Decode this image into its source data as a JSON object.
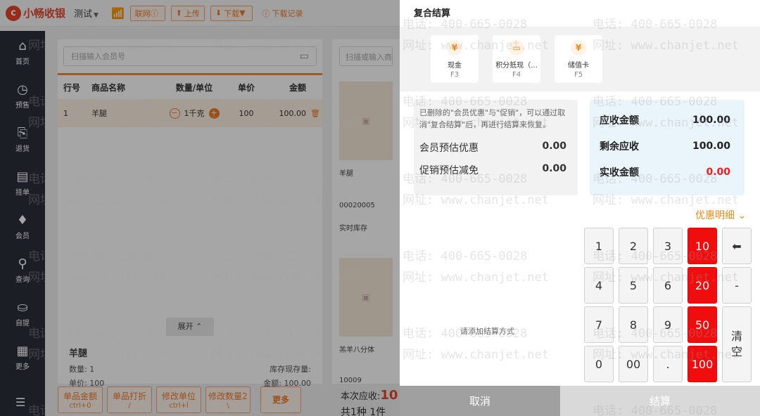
{
  "topbar": {
    "logo_mark": "c",
    "logo_text": "小畅收银",
    "env": "测试",
    "network": "联网",
    "upload": "上传",
    "download": "下载",
    "download_records": "下载记录"
  },
  "nav": [
    {
      "icon": "home-icon",
      "glyph": "⌂",
      "label": "首页"
    },
    {
      "icon": "clock-icon",
      "glyph": "◷",
      "label": "预售"
    },
    {
      "icon": "return-icon",
      "glyph": "⎘",
      "label": "退货"
    },
    {
      "icon": "hold-order-icon",
      "glyph": "▤",
      "label": "挂单"
    },
    {
      "icon": "member-icon",
      "glyph": "♦",
      "label": "会员"
    },
    {
      "icon": "search-icon",
      "glyph": "⚲",
      "label": "查询"
    },
    {
      "icon": "pickup-icon",
      "glyph": "⛀",
      "label": "自提"
    },
    {
      "icon": "more-grid-icon",
      "glyph": "▦",
      "label": "更多"
    }
  ],
  "cart": {
    "member_placeholder": "扫描输入会员号",
    "headers": {
      "no": "行号",
      "name": "商品名称",
      "qty": "数量/单位",
      "price": "单价",
      "amount": "金额"
    },
    "rows": [
      {
        "no": "1",
        "name": "羊腿",
        "qty": "1千克",
        "price": "100",
        "amount": "100.00"
      }
    ],
    "expand": "展开",
    "detail": {
      "name": "羊腿",
      "qty_label": "数量: 1",
      "stock_label": "库存现存量:",
      "price_label": "单价: 100",
      "amount_label": "金额: 100.00"
    }
  },
  "bottom_buttons": [
    {
      "label": "单品金额",
      "key": "ctrl+0"
    },
    {
      "label": "单品打折",
      "key": "/"
    },
    {
      "label": "修改单位",
      "key": "ctrl+l"
    },
    {
      "label": "修改数量2",
      "key": "\\"
    }
  ],
  "more_button": "更多",
  "products": {
    "search_placeholder": "扫描或输入商品",
    "p1_name": "羊腿",
    "p1_code": "00020005",
    "p1_stock": "实时库存",
    "p2_name": "羔羊八分体",
    "p2_code": "10009"
  },
  "due": {
    "label": "本次应收:",
    "value": "10",
    "sub": "共1种 1件"
  },
  "payment": {
    "title": "复合结算",
    "methods": [
      {
        "icon": "cash-icon",
        "glyph": "¥",
        "label": "现金",
        "key": "F3"
      },
      {
        "icon": "points-card-icon",
        "glyph": "▭",
        "label": "积分抵现（...",
        "key": "F4"
      },
      {
        "icon": "stored-value-icon",
        "glyph": "¥",
        "label": "储值卡",
        "key": "F5"
      }
    ],
    "discount_note": "已删除的\"会员优惠\"与\"促销\"，可以通过取消\"复合结算\"后，再进行结算来恢复。",
    "member_discount_label": "会员预估优惠",
    "member_discount_value": "0.00",
    "promo_discount_label": "促销预估减免",
    "promo_discount_value": "0.00",
    "receivable_label": "应收金额",
    "receivable_value": "100.00",
    "remaining_label": "剩余应收",
    "remaining_value": "100.00",
    "received_label": "实收金额",
    "received_value": "0.00",
    "coupon_link": "优惠明细",
    "add_hint": "请添加结算方式",
    "cancel": "取消",
    "settle": "结算",
    "keys": {
      "k1": "1",
      "k2": "2",
      "k3": "3",
      "k10": "10",
      "backspace": "⬅",
      "k4": "4",
      "k5": "5",
      "k6": "6",
      "k20": "20",
      "minus": "-",
      "k7": "7",
      "k8": "8",
      "k9": "9",
      "k50": "50",
      "clear": "清空",
      "k0": "0",
      "k00": "00",
      "dot": ".",
      "k100": "100"
    }
  },
  "watermark": {
    "phone": "电话: 400-665-0028",
    "site": "网址: www.chanjet.net"
  },
  "colors": {
    "accent": "#f07a2a",
    "danger": "#f00d0d",
    "nav_bg": "#2b2f3a"
  }
}
